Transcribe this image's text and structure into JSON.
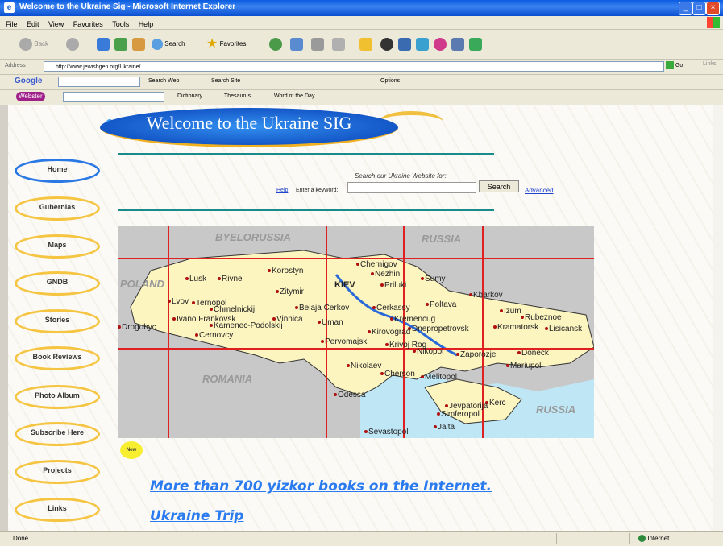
{
  "window": {
    "title": "Welcome to the Ukraine Sig - Microsoft Internet Explorer"
  },
  "menu": [
    "File",
    "Edit",
    "View",
    "Favorites",
    "Tools",
    "Help"
  ],
  "toolbar": {
    "back": "Back",
    "search": "Search",
    "favorites": "Favorites"
  },
  "address": {
    "label": "Address",
    "url": "http://www.jewishgen.org/Ukraine/",
    "go": "Go",
    "links": "Links"
  },
  "googlebar": {
    "logo": "Google",
    "search_web": "Search Web",
    "search_site": "Search Site",
    "options": "Options"
  },
  "webstersbar": {
    "logo": "Webster",
    "dictionary": "Dictionary",
    "thesaurus": "Thesaurus",
    "word_of_day": "Word of the Day"
  },
  "page": {
    "banner": "Welcome to the Ukraine SIG",
    "search_prompt": "Search our Ukraine Website for:",
    "help": "Help",
    "keyword_label": "Enter a keyword:",
    "search_button": "Search",
    "advanced": "Advanced",
    "new_badge": "New",
    "links": [
      "More than 700 yizkor books on the Internet.",
      "Ukraine Trip"
    ]
  },
  "nav": [
    "Home",
    "Gubernias",
    "Maps",
    "GNDB",
    "Stories",
    "Book Reviews",
    "Photo Album",
    "Subscribe Here",
    "Projects",
    "Links"
  ],
  "map": {
    "countries": [
      "BYELORUSSIA",
      "RUSSIA",
      "POLAND",
      "ROMANIA",
      "RUSSIA"
    ],
    "capital": "KIEV",
    "cities": [
      "Lusk",
      "Rivne",
      "Korostyn",
      "Zitymir",
      "Chernigov",
      "Nezhin",
      "Priluki",
      "Sumy",
      "Kharkov",
      "Lvov",
      "Ternopol",
      "Chmelnickij",
      "Belaja Cerkov",
      "Cerkassy",
      "Poltava",
      "Ivano Frankovsk",
      "Kamenec-Podolskij",
      "Vinnica",
      "Uman",
      "Kremencug",
      "Dnepropetrovsk",
      "Izum",
      "Rubeznoe",
      "Lisicansk",
      "Drogobyc",
      "Cernovcy",
      "Kramatorsk",
      "Pervomajsk",
      "Krivoj Rog",
      "Kirovograd",
      "Zaporozje",
      "Nikopol",
      "Doneck",
      "Mariupol",
      "Nikolaev",
      "Cherson",
      "Melitopol",
      "Odessa",
      "Kerc",
      "Jevpatorija",
      "Simferopol",
      "Sevastopol",
      "Jalta"
    ]
  },
  "status": {
    "left": "Done",
    "zone": "Internet"
  },
  "colors": {
    "banner_blue": "#1457c8",
    "nav_ring": "#f5c542",
    "link_blue": "#2a7af0",
    "map_land": "#fdf5c0",
    "map_sea": "#bfe6f5",
    "map_grid": "#e02020"
  }
}
